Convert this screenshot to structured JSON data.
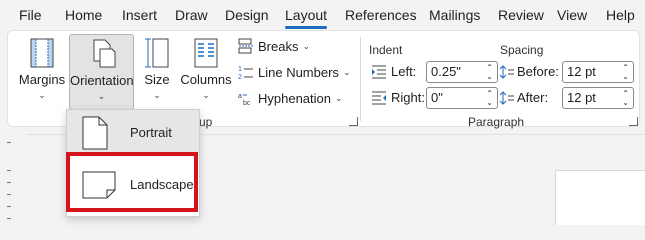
{
  "tabs": [
    {
      "label": "File"
    },
    {
      "label": "Home"
    },
    {
      "label": "Insert"
    },
    {
      "label": "Draw"
    },
    {
      "label": "Design"
    },
    {
      "label": "Layout"
    },
    {
      "label": "References"
    },
    {
      "label": "Mailings"
    },
    {
      "label": "Review"
    },
    {
      "label": "View"
    },
    {
      "label": "Help"
    }
  ],
  "active_tab": "Layout",
  "page_setup": {
    "margins": "Margins",
    "orientation": "Orientation",
    "size": "Size",
    "columns": "Columns",
    "breaks": "Breaks",
    "line_numbers": "Line Numbers",
    "hyphenation": "Hyphenation",
    "group_label_fragment": "up"
  },
  "paragraph": {
    "indent_title": "Indent",
    "spacing_title": "Spacing",
    "left_label": "Left:",
    "left_value": "0.25\"",
    "right_label": "Right:",
    "right_value": "0\"",
    "before_label": "Before:",
    "before_value": "12 pt",
    "after_label": "After:",
    "after_value": "12 pt",
    "group_label": "Paragraph"
  },
  "orientation_menu": {
    "items": [
      {
        "label": "Portrait",
        "selected": true
      },
      {
        "label": "Landscape",
        "selected": false
      }
    ],
    "highlighted": "Landscape"
  },
  "colors": {
    "accent": "#1e6bbf",
    "highlight": "#d4131b"
  }
}
